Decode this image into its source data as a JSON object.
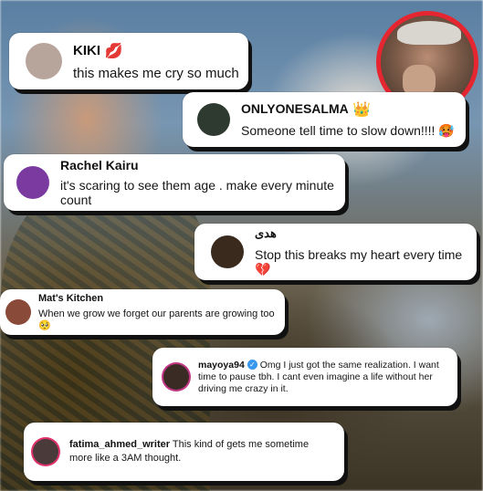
{
  "comments": [
    {
      "name": "KIKI",
      "badge": "💋",
      "text": "this makes me cry so much"
    },
    {
      "name": "ONLYONESALMA",
      "badge": "👑",
      "text": "Someone tell time to slow down!!!! 🥵"
    },
    {
      "name": "Rachel Kairu",
      "text": "it's scaring to see them age . make every minute count"
    },
    {
      "name": "هدى",
      "text": "Stop this breaks my heart every time 💔"
    },
    {
      "name": "Mat's Kitchen",
      "text": "When we grow we forget our parents are growing too 🥺"
    },
    {
      "name": "mayoya94",
      "text": "Omg I just got the same realization. I want time to pause tbh. I cant even imagine a life without her driving me crazy in it."
    },
    {
      "name": "fatima_ahmed_writer",
      "text": "This kind of gets me sometime more like a 3AM thought."
    }
  ],
  "colors": {
    "ring": "#e52630",
    "verified": "#3897f0"
  },
  "icons": {
    "verified": "verified-check-icon"
  }
}
